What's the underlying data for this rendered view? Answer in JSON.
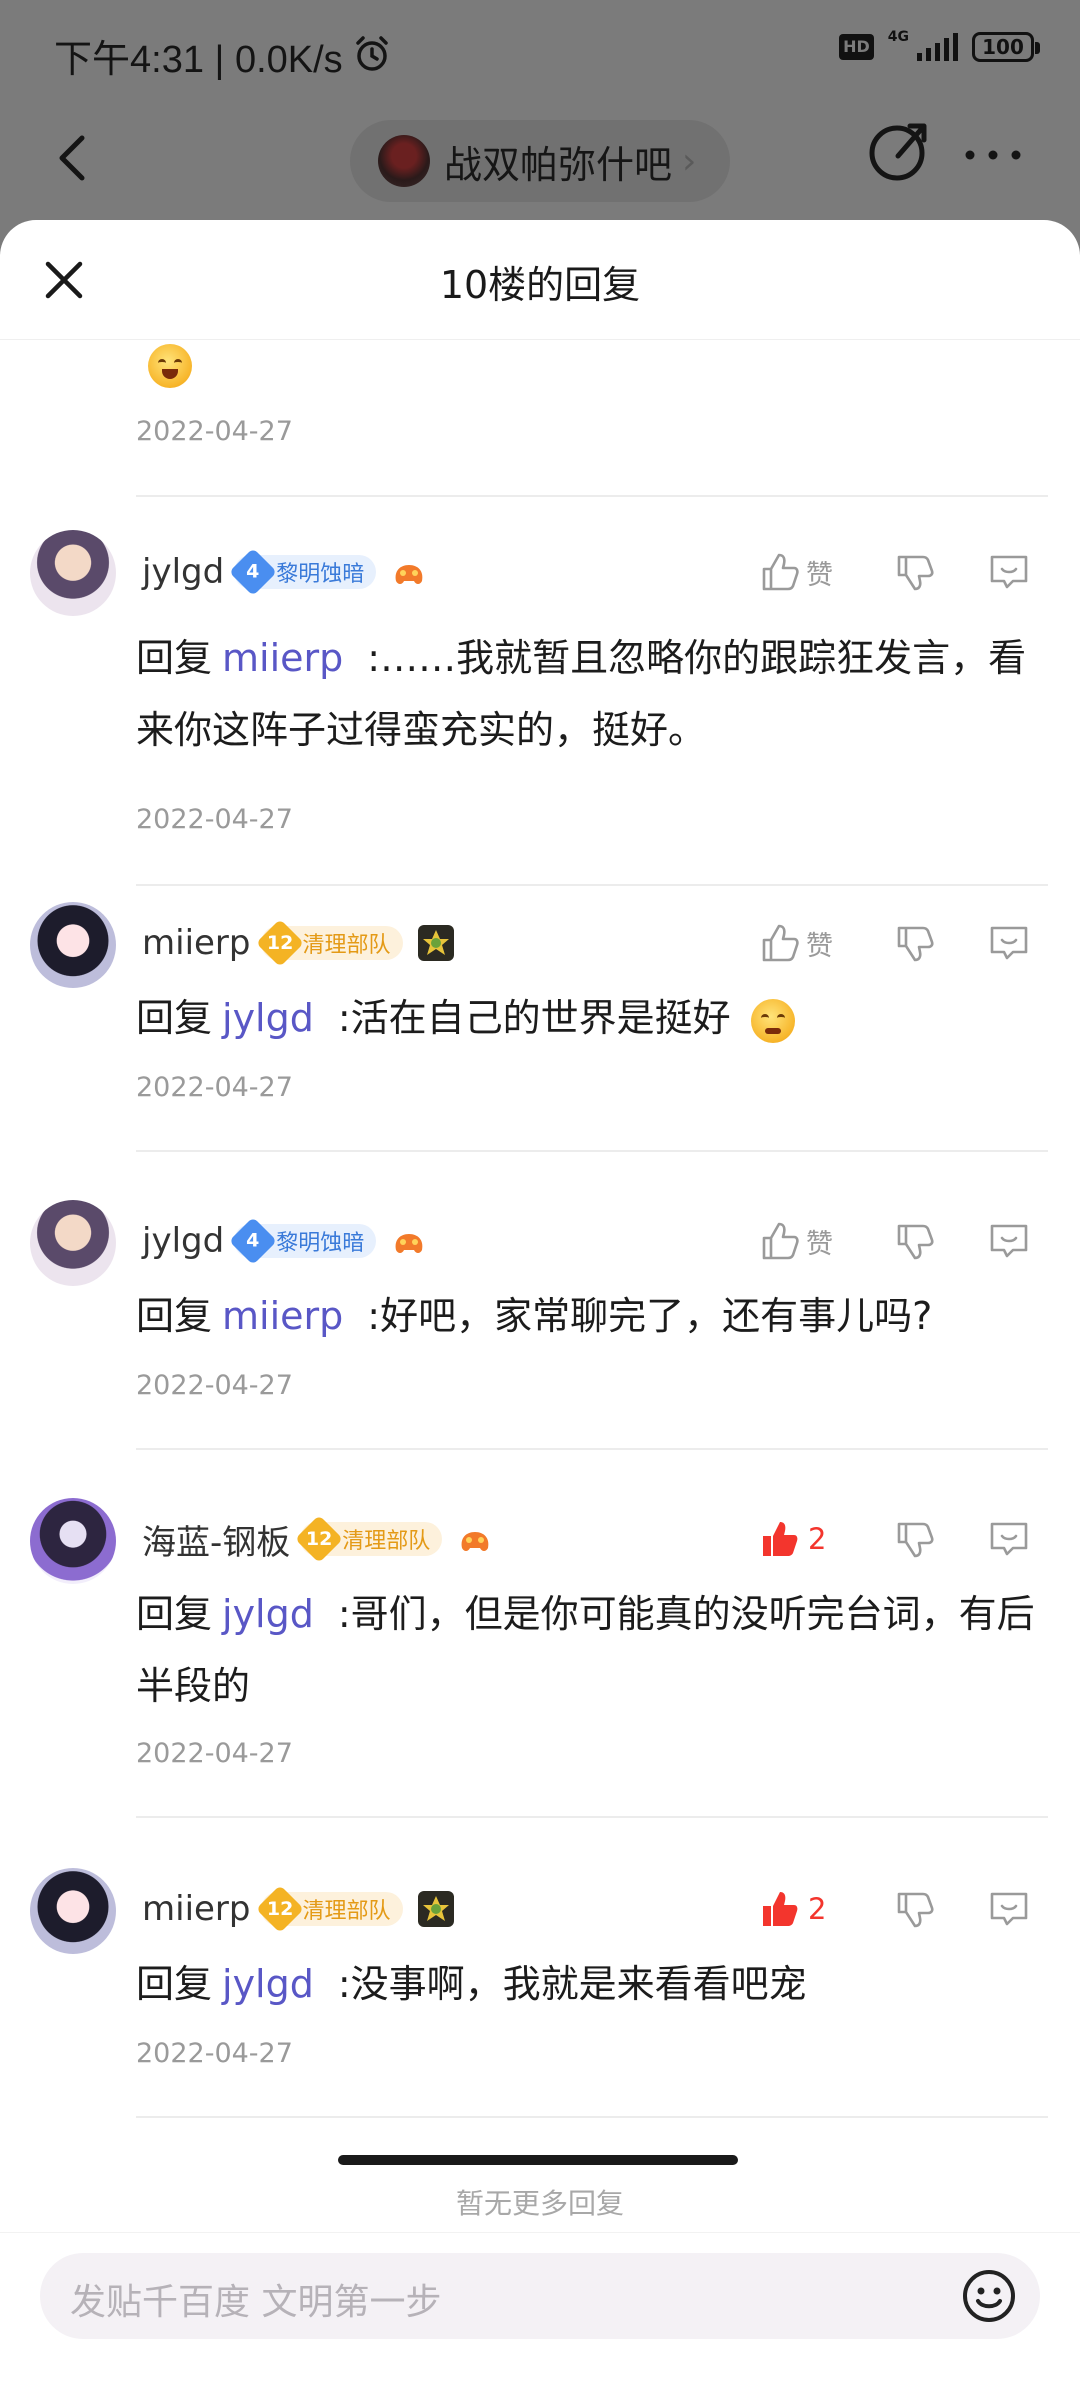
{
  "status_bar": {
    "time": "下午4:31 | 0.0K/s",
    "alarm_icon": "alarm-icon",
    "hd_label": "HD",
    "network_label": "4G",
    "battery": "100"
  },
  "top_nav": {
    "back_icon": "chevron-left-icon",
    "forum_name": "战双帕弥什吧",
    "forum_chevron": "›",
    "share_icon": "share-icon",
    "more_icon": "more-icon"
  },
  "sheet": {
    "title": "10楼的回复",
    "close_icon": "close-icon"
  },
  "top_item": {
    "date": "2022-04-27"
  },
  "comments": [
    {
      "username": "jylgd",
      "badge_level": "4",
      "badge_text": "黎明蚀暗",
      "like_label": "赞",
      "liked": false,
      "reply_prefix": "回复",
      "mention": "miierp",
      "text": ":……我就暂且忽略你的跟踪狂发言，看来你这阵子过得蛮充实的，挺好。",
      "date": "2022-04-27"
    },
    {
      "username": "miierp",
      "badge_level": "12",
      "badge_text": "清理部队",
      "like_label": "赞",
      "liked": false,
      "reply_prefix": "回复",
      "mention": "jylgd",
      "text": ":活在自己的世界是挺好",
      "date": "2022-04-27"
    },
    {
      "username": "jylgd",
      "badge_level": "4",
      "badge_text": "黎明蚀暗",
      "like_label": "赞",
      "liked": false,
      "reply_prefix": "回复",
      "mention": "miierp",
      "text": ":好吧，家常聊完了，还有事儿吗?",
      "date": "2022-04-27"
    },
    {
      "username": "海蓝-钢板",
      "badge_level": "12",
      "badge_text": "清理部队",
      "like_label": "2",
      "liked": true,
      "reply_prefix": "回复",
      "mention": "jylgd",
      "text": ":哥们，但是你可能真的没听完台词，有后半段的",
      "date": "2022-04-27"
    },
    {
      "username": "miierp",
      "badge_level": "12",
      "badge_text": "清理部队",
      "like_label": "2",
      "liked": true,
      "reply_prefix": "回复",
      "mention": "jylgd",
      "text": ":没事啊，我就是来看看吧宠",
      "date": "2022-04-27"
    }
  ],
  "footer": {
    "no_more": "暂无更多回复",
    "input_placeholder": "发贴千百度 文明第一步",
    "emoji_icon": "smile-icon"
  },
  "colors": {
    "mention": "#5957c6",
    "liked_red": "#f3352d",
    "badge_blue": "#4a8ef0",
    "badge_gold": "#f4b324"
  }
}
